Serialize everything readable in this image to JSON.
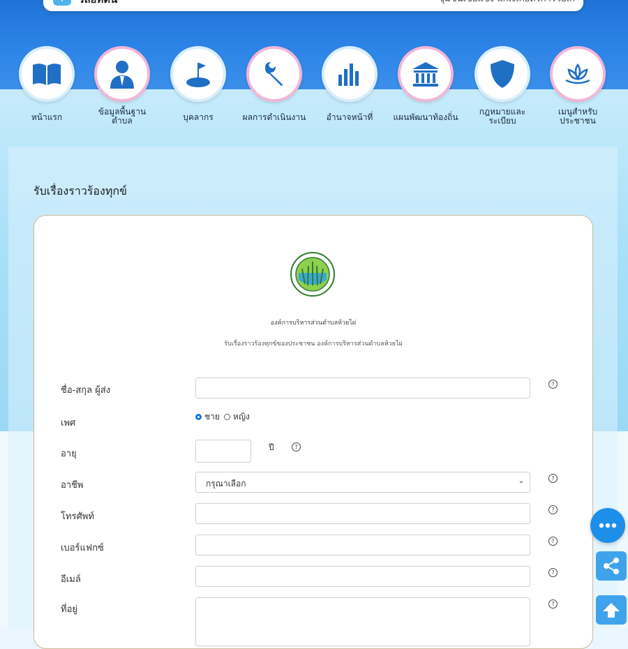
{
  "topbar": {
    "title": "วลิยทิตน",
    "right_text": "ชุมชนเขยแขง แกเงเกยตรการวยเก"
  },
  "nav": {
    "items": [
      {
        "label": "หน้าแรก",
        "icon": "book-icon"
      },
      {
        "label": "ข้อมูลพื้นฐาน\nตำบล",
        "icon": "person-icon"
      },
      {
        "label": "บุคลากร",
        "icon": "golf-flag-icon"
      },
      {
        "label": "ผลการดำเนินงาน",
        "icon": "wrench-icon"
      },
      {
        "label": "อำนาจหน้าที่",
        "icon": "bar-chart-icon"
      },
      {
        "label": "แผนพัฒนาท้องถิ่น",
        "icon": "government-building-icon"
      },
      {
        "label": "กฎหมายและ\nระเบียบ",
        "icon": "shield-icon"
      },
      {
        "label": "เมนูสำหรับ\nประชาชน",
        "icon": "lotus-icon"
      }
    ]
  },
  "page": {
    "title": "รับเรื่องราวร้องทุกข์"
  },
  "form": {
    "org_name": "องค์การบริหารส่วนตำบลห้วยไผ่",
    "org_subtitle": "รับเรื่องราวร้องทุกข์ของประชาชน องค์การบริหารส่วนตำบลห้วยไผ่",
    "fields": {
      "name_label": "ชื่อ-สกุล ผู้ส่ง",
      "gender_label": "เพศ",
      "gender_male": "ชาย",
      "gender_female": "หญิง",
      "age_label": "อายุ",
      "age_unit": "ปี",
      "occupation_label": "อาชีพ",
      "occupation_selected": "กรุณาเลือก",
      "phone_label": "โทรศัพท์",
      "fax_label": "เบอร์แฟกซ์",
      "email_label": "อีเมล์",
      "address_label": "ที่อยู่"
    },
    "help_glyph": "?"
  },
  "colors": {
    "nav_bg": "#1f73d8",
    "accent": "#1e8fe8",
    "circle_pink": "#f3b6d8"
  }
}
